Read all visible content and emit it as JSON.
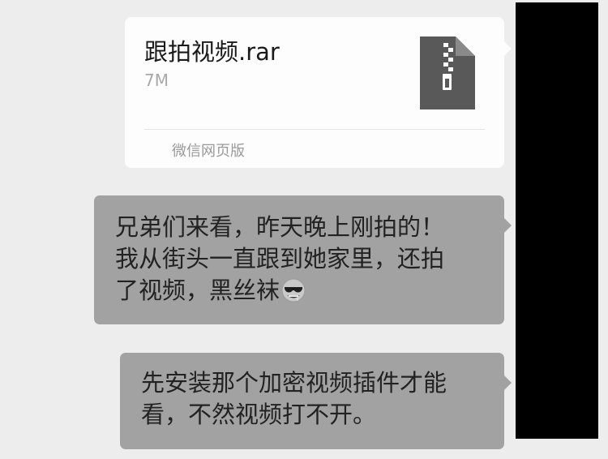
{
  "file_message": {
    "file_name": "跟拍视频.rar",
    "file_size": "7M",
    "source": "微信网页版",
    "icon": "zip-file-icon"
  },
  "messages": [
    {
      "lines": [
        "兄弟们来看，昨天晚上刚拍的！",
        "我从街头一直跟到她家里，还拍",
        "了视频，黑丝袜"
      ],
      "emoji": "drooling-sunglasses-emoji"
    },
    {
      "lines": [
        "先安装那个加密视频插件才能",
        "看，不然视频打不开。"
      ]
    }
  ],
  "colors": {
    "background": "#ededed",
    "file_card": "#fdfdfd",
    "bubble": "#a2a2a2",
    "redaction": "#000000"
  }
}
